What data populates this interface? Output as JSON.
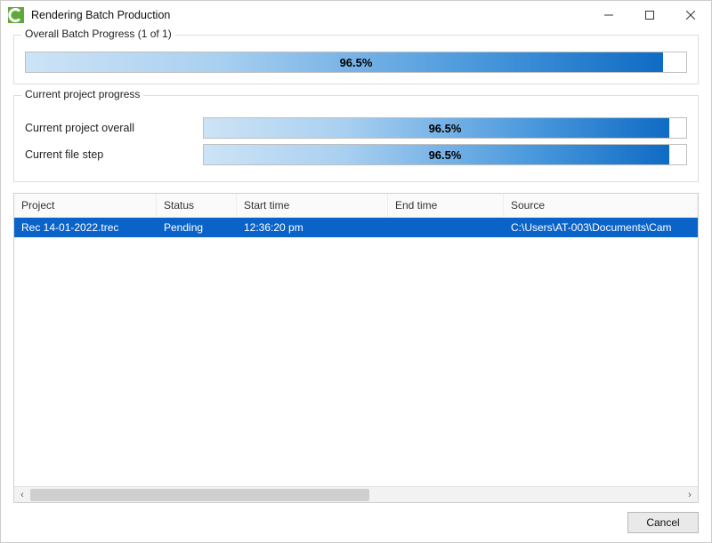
{
  "window": {
    "title": "Rendering Batch Production"
  },
  "overall": {
    "legend": "Overall Batch Progress (1 of 1)",
    "percent_label": "96.5%",
    "percent_value": 96.5
  },
  "current": {
    "legend": "Current project progress",
    "overall_label": "Current project overall",
    "overall_percent_label": "96.5%",
    "overall_percent_value": 96.5,
    "file_label": "Current file step",
    "file_percent_label": "96.5%",
    "file_percent_value": 96.5
  },
  "grid": {
    "columns": {
      "project": "Project",
      "status": "Status",
      "starttime": "Start time",
      "endtime": "End time",
      "source": "Source"
    },
    "rows": [
      {
        "project": "Rec 14-01-2022.trec",
        "status": "Pending",
        "starttime": "12:36:20 pm",
        "endtime": "",
        "source": "C:\\Users\\AT-003\\Documents\\Cam"
      }
    ]
  },
  "footer": {
    "cancel_label": "Cancel"
  }
}
